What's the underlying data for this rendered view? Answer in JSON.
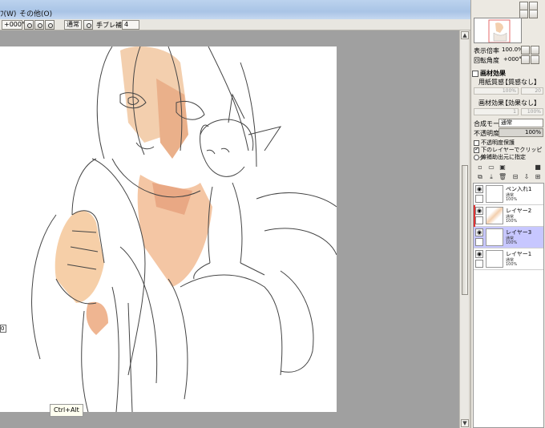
{
  "menubar": {
    "items": [
      "ﾌ(W)",
      "その他(O)"
    ]
  },
  "toolbar": {
    "angle": "+000°",
    "blend_mode": "通常",
    "stabilizer_label": "手ブレ補正",
    "stabilizer_value": "4"
  },
  "canvas": {
    "tooltip": "Ctrl+Alt",
    "edge_box_text": "0"
  },
  "navigator": {
    "zoom_label": "表示倍率",
    "zoom_value": "100.0%",
    "rotation_label": "回転角度",
    "rotation_value": "+000°"
  },
  "texture": {
    "section_label": "画材効果",
    "paper_label": "用紙質感",
    "paper_value": "【質感なし】",
    "paper_scale_value": "100%",
    "paper_strength_value": "20",
    "effect_label": "画材効果",
    "effect_value": "【効果なし】",
    "effect_scale_value": "1",
    "effect_strength_value": "100%"
  },
  "layer_props": {
    "blend_label": "合成モード",
    "blend_value": "通常",
    "opacity_label": "不透明度",
    "opacity_value": "100%",
    "protect_opacity_label": "不透明度保護",
    "clip_label": "下のレイヤーでクリッピング",
    "reference_label": "線補助出元に指定"
  },
  "layers": [
    {
      "name": "ペン入れ1",
      "mode": "通常",
      "opacity": "100%",
      "selected": false,
      "marked": false
    },
    {
      "name": "レイヤー2",
      "mode": "通常",
      "opacity": "100%",
      "selected": false,
      "marked": true
    },
    {
      "name": "レイヤー3",
      "mode": "通常",
      "opacity": "100%",
      "selected": true,
      "marked": false
    },
    {
      "name": "レイヤー1",
      "mode": "通常",
      "opacity": "100%",
      "selected": false,
      "marked": false
    }
  ],
  "icons": {
    "visibility": "eye-icon",
    "lock": "lock-icon",
    "new_layer": "new-layer-icon",
    "delete": "trash-icon"
  },
  "colors": {
    "skin": "#f5cba7",
    "shade": "#e6a57e",
    "selected_layer": "#c7c7ff",
    "mark": "#e23232"
  }
}
